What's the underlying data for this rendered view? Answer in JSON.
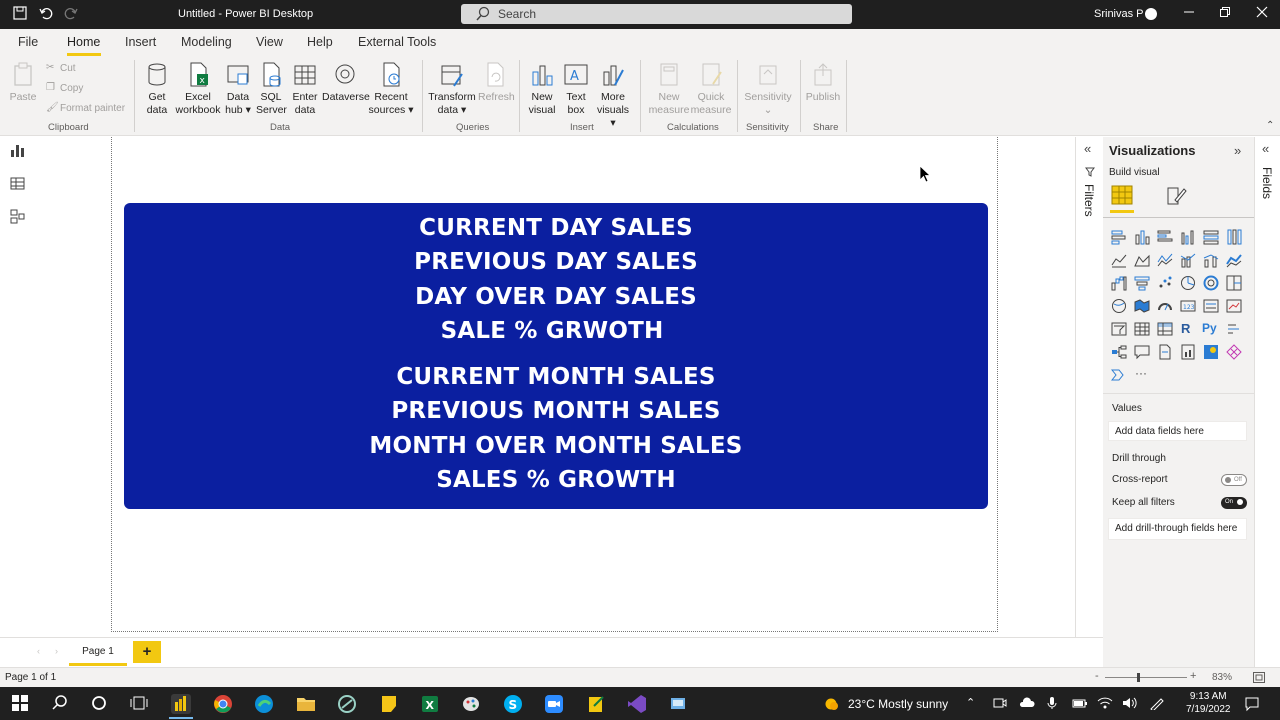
{
  "app": {
    "title": "Untitled - Power BI Desktop",
    "search_placeholder": "Search",
    "user_name": "Srinivas P"
  },
  "menu": {
    "tabs": [
      "File",
      "Home",
      "Insert",
      "Modeling",
      "View",
      "Help",
      "External Tools"
    ],
    "active_tab": "Home"
  },
  "ribbon": {
    "clipboard": {
      "paste": "Paste",
      "cut": "Cut",
      "copy": "Copy",
      "format_painter": "Format painter",
      "group": "Clipboard"
    },
    "data": {
      "get_data": [
        "Get",
        "data"
      ],
      "excel": [
        "Excel",
        "workbook"
      ],
      "data_hub": [
        "Data",
        "hub"
      ],
      "sql": [
        "SQL",
        "Server"
      ],
      "enter": [
        "Enter",
        "data"
      ],
      "dataverse": "Dataverse",
      "recent": [
        "Recent",
        "sources"
      ],
      "group": "Data"
    },
    "queries": {
      "transform": [
        "Transform",
        "data"
      ],
      "refresh": "Refresh",
      "group": "Queries"
    },
    "insert": {
      "new_visual": [
        "New",
        "visual"
      ],
      "text_box": [
        "Text",
        "box"
      ],
      "more_visuals": [
        "More",
        "visuals"
      ],
      "group": "Insert"
    },
    "calculations": {
      "new_measure": [
        "New",
        "measure"
      ],
      "quick_measure": [
        "Quick",
        "measure"
      ],
      "group": "Calculations"
    },
    "sensitivity": {
      "label": "Sensitivity",
      "group": "Sensitivity"
    },
    "share": {
      "publish": "Publish",
      "group": "Share"
    }
  },
  "card": {
    "lines": [
      "CURRENT DAY SALES",
      "PREVIOUS DAY SALES",
      "DAY OVER DAY SALES",
      "SALE % GRWOTH",
      "CURRENT MONTH SALES",
      "PREVIOUS MONTH SALES",
      "MONTH OVER MONTH SALES",
      "SALES % GROWTH"
    ],
    "background": "#0b1fa0"
  },
  "filters_label": "Filters",
  "visualizations": {
    "title": "Visualizations",
    "build_visual": "Build visual",
    "values_label": "Values",
    "values_placeholder": "Add data fields here",
    "drill_through": "Drill through",
    "cross_report": "Cross-report",
    "cross_report_state": "Off",
    "keep_all_filters": "Keep all filters",
    "keep_all_filters_state": "On",
    "drill_placeholder": "Add drill-through fields here",
    "r_label": "R",
    "py_label": "Py",
    "more": "···"
  },
  "fields_label": "Fields",
  "pages": {
    "tabs": [
      "Page 1"
    ],
    "add": "+"
  },
  "status": {
    "page": "Page 1 of 1",
    "zoom": "83%"
  },
  "taskbar": {
    "weather": "23°C  Mostly sunny",
    "time": "9:13 AM",
    "date": "7/19/2022"
  },
  "colors": {
    "accent": "#f2c811",
    "card_blue": "#0b1fa0",
    "title_bar": "#1f1f1f"
  }
}
